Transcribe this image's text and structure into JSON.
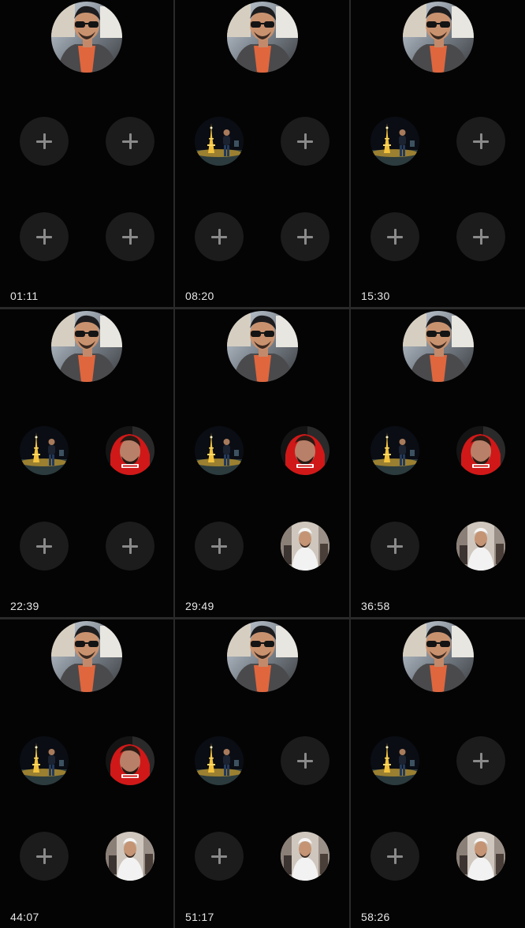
{
  "frames": [
    {
      "timestamp": "01:11",
      "slots": [
        "empty",
        "empty",
        "empty",
        "empty"
      ]
    },
    {
      "timestamp": "08:20",
      "slots": [
        "eiffel",
        "empty",
        "empty",
        "empty"
      ]
    },
    {
      "timestamp": "15:30",
      "slots": [
        "eiffel",
        "empty",
        "empty",
        "empty"
      ]
    },
    {
      "timestamp": "22:39",
      "slots": [
        "eiffel",
        "red",
        "empty",
        "empty"
      ]
    },
    {
      "timestamp": "29:49",
      "slots": [
        "eiffel",
        "red",
        "empty",
        "white"
      ]
    },
    {
      "timestamp": "36:58",
      "slots": [
        "eiffel",
        "red",
        "empty",
        "white"
      ]
    },
    {
      "timestamp": "44:07",
      "slots": [
        "eiffel",
        "red",
        "empty",
        "white"
      ]
    },
    {
      "timestamp": "51:17",
      "slots": [
        "eiffel",
        "empty",
        "empty",
        "white"
      ]
    },
    {
      "timestamp": "58:26",
      "slots": [
        "eiffel",
        "empty",
        "empty",
        "white"
      ]
    }
  ],
  "participants": {
    "host": {
      "icon": "host-avatar"
    },
    "eiffel": {
      "icon": "eiffel-tower-avatar"
    },
    "red": {
      "icon": "red-hoodie-avatar"
    },
    "white": {
      "icon": "white-robe-avatar"
    },
    "empty": {
      "icon": "add-guest-plus-icon"
    }
  },
  "colors": {
    "background": "#040404",
    "divider": "#2a2a2a",
    "empty_slot": "#1c1c1c",
    "plus": "#8a8a8a",
    "timestamp": "#e6e6e6",
    "hoodie_red": "#d01818",
    "robe_white": "#f2f2f2"
  }
}
